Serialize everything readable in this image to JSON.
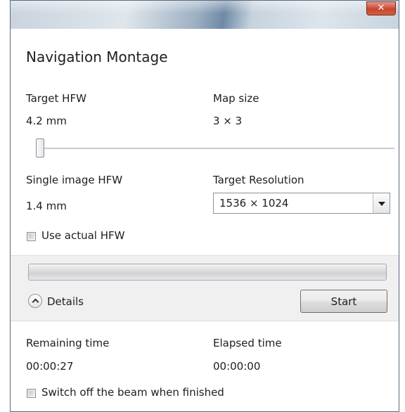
{
  "window": {
    "close_symbol": "✕",
    "title": "Navigation Montage"
  },
  "target_hfw": {
    "label": "Target HFW",
    "value": "4.2 mm"
  },
  "map_size": {
    "label": "Map size",
    "value": "3 × 3"
  },
  "hfw_slider": {
    "position_fraction": 0.0
  },
  "single_image_hfw": {
    "label": "Single image HFW",
    "value": "1.4 mm"
  },
  "target_resolution": {
    "label": "Target Resolution",
    "selected": "1536 × 1024"
  },
  "use_actual_hfw": {
    "label": "Use actual HFW",
    "checked": false
  },
  "progress": {
    "fraction": 0.0
  },
  "details": {
    "label": "Details"
  },
  "start_button": {
    "label": "Start"
  },
  "remaining_time": {
    "label": "Remaining time",
    "value": "00:00:27"
  },
  "elapsed_time": {
    "label": "Elapsed time",
    "value": "00:00:00"
  },
  "switch_off_beam": {
    "label": "Switch off the beam when finished",
    "checked": false
  },
  "colors": {
    "progress_fill": "#37b34a",
    "close_button": "#c7452f"
  }
}
